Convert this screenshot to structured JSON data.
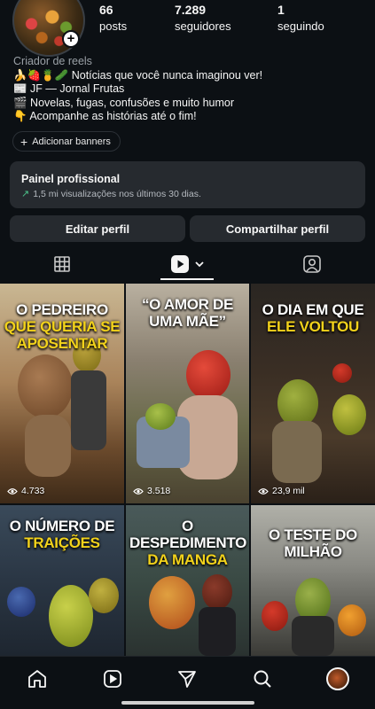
{
  "profile": {
    "stats": [
      {
        "value": "66",
        "label": "posts"
      },
      {
        "value": "7.289",
        "label": "seguidores"
      },
      {
        "value": "1",
        "label": "seguindo"
      }
    ],
    "category": "Criador de reels",
    "bio_lines": [
      "🍌🍓🍍🥒 Notícias que você nunca imaginou ver!",
      "📰 JF — Jornal Frutas",
      "🎬 Novelas, fugas, confusões e muito humor",
      "👇 Acompanhe as histórias até o fim!"
    ],
    "add_banners_label": "Adicionar banners"
  },
  "professional_panel": {
    "title": "Painel profissional",
    "subtitle": "1,5 mi visualizações nos últimos 30 dias."
  },
  "actions": {
    "edit_profile": "Editar perfil",
    "share_profile": "Compartilhar perfil"
  },
  "tabs": [
    {
      "icon": "grid-icon",
      "active": false
    },
    {
      "icon": "reels-icon",
      "active": true
    },
    {
      "icon": "tagged-icon",
      "active": false
    }
  ],
  "reels": [
    {
      "title_white": "O PEDREIRO",
      "title_yellow": "QUE QUERIA SE APOSENTAR",
      "views": "4.733"
    },
    {
      "title_white": "“O AMOR DE UMA MÃE”",
      "title_yellow": "",
      "views": "3.518"
    },
    {
      "title_white": "O DIA EM QUE",
      "title_yellow": "ELE VOLTOU",
      "views": "23,9 mil"
    },
    {
      "title_white": "O NÚMERO DE",
      "title_yellow": "TRAIÇÕES",
      "views": ""
    },
    {
      "title_white": "O DESPEDIMENTO",
      "title_yellow": "DA MANGA",
      "views": ""
    },
    {
      "title_white": "O TESTE DO",
      "title_yellow": "MILHÃO",
      "views": ""
    }
  ],
  "bottom_nav": [
    "home-icon",
    "reels-icon",
    "send-icon",
    "search-icon",
    "profile-avatar"
  ],
  "colors": {
    "background": "#0c1014",
    "panel": "#262a2f",
    "title_yellow": "#f2d21b",
    "trend_green": "#4cc38a"
  }
}
